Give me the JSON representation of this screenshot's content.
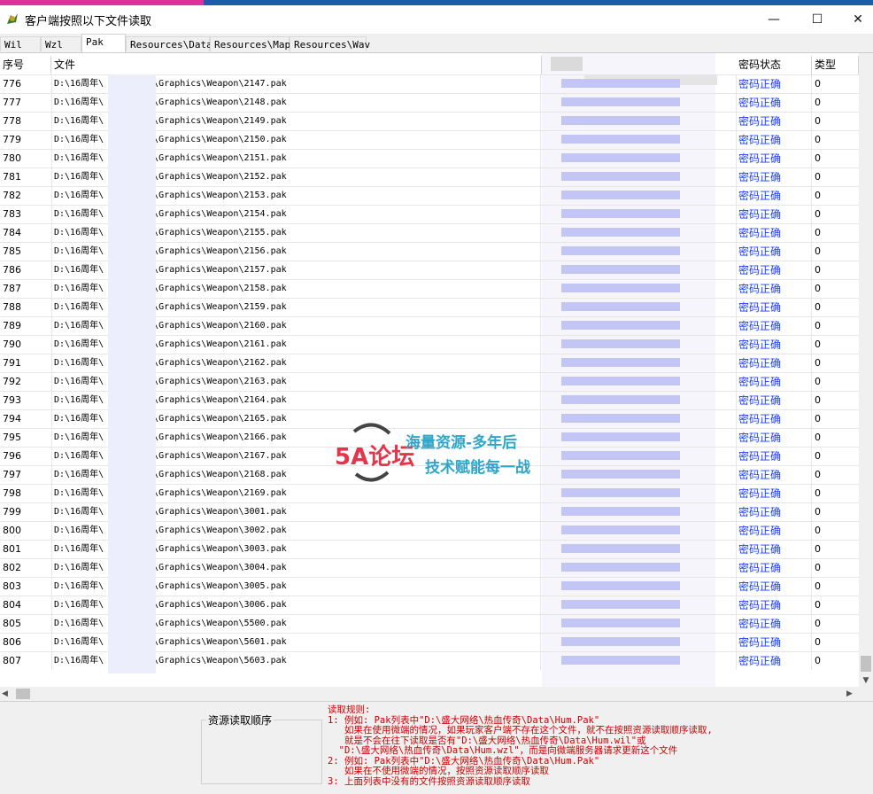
{
  "window": {
    "title": "客户端按照以下文件读取",
    "controls": {
      "minimize": "—",
      "maximize": "☐",
      "close": "✕"
    }
  },
  "tabs": [
    "Wil",
    "Wzl",
    "Pak",
    "Resources\\Data",
    "Resources\\Map",
    "Resources\\Wav"
  ],
  "active_tab": "Pak",
  "table": {
    "columns": [
      "序号",
      "文件",
      "密码状态",
      "类型"
    ],
    "rows": [
      {
        "idx": "776",
        "file": "D:\\16周年\\",
        "path": "\\Graphics\\Weapon\\2147.pak",
        "pwd": "密码正确",
        "type": "0"
      },
      {
        "idx": "777",
        "file": "D:\\16周年\\",
        "path": "\\Graphics\\Weapon\\2148.pak",
        "pwd": "密码正确",
        "type": "0"
      },
      {
        "idx": "778",
        "file": "D:\\16周年\\",
        "path": "\\Graphics\\Weapon\\2149.pak",
        "pwd": "密码正确",
        "type": "0"
      },
      {
        "idx": "779",
        "file": "D:\\16周年\\",
        "path": "\\Graphics\\Weapon\\2150.pak",
        "pwd": "密码正确",
        "type": "0"
      },
      {
        "idx": "780",
        "file": "D:\\16周年\\",
        "path": "\\Graphics\\Weapon\\2151.pak",
        "pwd": "密码正确",
        "type": "0"
      },
      {
        "idx": "781",
        "file": "D:\\16周年\\",
        "path": "\\Graphics\\Weapon\\2152.pak",
        "pwd": "密码正确",
        "type": "0"
      },
      {
        "idx": "782",
        "file": "D:\\16周年\\",
        "path": "\\Graphics\\Weapon\\2153.pak",
        "pwd": "密码正确",
        "type": "0"
      },
      {
        "idx": "783",
        "file": "D:\\16周年\\",
        "path": "\\Graphics\\Weapon\\2154.pak",
        "pwd": "密码正确",
        "type": "0"
      },
      {
        "idx": "784",
        "file": "D:\\16周年\\",
        "path": "\\Graphics\\Weapon\\2155.pak",
        "pwd": "密码正确",
        "type": "0"
      },
      {
        "idx": "785",
        "file": "D:\\16周年\\",
        "path": "\\Graphics\\Weapon\\2156.pak",
        "pwd": "密码正确",
        "type": "0"
      },
      {
        "idx": "786",
        "file": "D:\\16周年\\",
        "path": "\\Graphics\\Weapon\\2157.pak",
        "pwd": "密码正确",
        "type": "0"
      },
      {
        "idx": "787",
        "file": "D:\\16周年\\",
        "path": "\\Graphics\\Weapon\\2158.pak",
        "pwd": "密码正确",
        "type": "0"
      },
      {
        "idx": "788",
        "file": "D:\\16周年\\",
        "path": "\\Graphics\\Weapon\\2159.pak",
        "pwd": "密码正确",
        "type": "0"
      },
      {
        "idx": "789",
        "file": "D:\\16周年\\",
        "path": "\\Graphics\\Weapon\\2160.pak",
        "pwd": "密码正确",
        "type": "0"
      },
      {
        "idx": "790",
        "file": "D:\\16周年\\",
        "path": "\\Graphics\\Weapon\\2161.pak",
        "pwd": "密码正确",
        "type": "0"
      },
      {
        "idx": "791",
        "file": "D:\\16周年\\",
        "path": "\\Graphics\\Weapon\\2162.pak",
        "pwd": "密码正确",
        "type": "0"
      },
      {
        "idx": "792",
        "file": "D:\\16周年\\",
        "path": "\\Graphics\\Weapon\\2163.pak",
        "pwd": "密码正确",
        "type": "0"
      },
      {
        "idx": "793",
        "file": "D:\\16周年\\",
        "path": "\\Graphics\\Weapon\\2164.pak",
        "pwd": "密码正确",
        "type": "0"
      },
      {
        "idx": "794",
        "file": "D:\\16周年\\",
        "path": "\\Graphics\\Weapon\\2165.pak",
        "pwd": "密码正确",
        "type": "0"
      },
      {
        "idx": "795",
        "file": "D:\\16周年\\",
        "path": "\\Graphics\\Weapon\\2166.pak",
        "pwd": "密码正确",
        "type": "0"
      },
      {
        "idx": "796",
        "file": "D:\\16周年\\",
        "path": "\\Graphics\\Weapon\\2167.pak",
        "pwd": "密码正确",
        "type": "0"
      },
      {
        "idx": "797",
        "file": "D:\\16周年\\",
        "path": "\\Graphics\\Weapon\\2168.pak",
        "pwd": "密码正确",
        "type": "0"
      },
      {
        "idx": "798",
        "file": "D:\\16周年\\",
        "path": "\\Graphics\\Weapon\\2169.pak",
        "pwd": "密码正确",
        "type": "0"
      },
      {
        "idx": "799",
        "file": "D:\\16周年\\",
        "path": "\\Graphics\\Weapon\\3001.pak",
        "pwd": "密码正确",
        "type": "0"
      },
      {
        "idx": "800",
        "file": "D:\\16周年\\",
        "path": "\\Graphics\\Weapon\\3002.pak",
        "pwd": "密码正确",
        "type": "0"
      },
      {
        "idx": "801",
        "file": "D:\\16周年\\",
        "path": "\\Graphics\\Weapon\\3003.pak",
        "pwd": "密码正确",
        "type": "0"
      },
      {
        "idx": "802",
        "file": "D:\\16周年\\",
        "path": "\\Graphics\\Weapon\\3004.pak",
        "pwd": "密码正确",
        "type": "0"
      },
      {
        "idx": "803",
        "file": "D:\\16周年\\",
        "path": "\\Graphics\\Weapon\\3005.pak",
        "pwd": "密码正确",
        "type": "0"
      },
      {
        "idx": "804",
        "file": "D:\\16周年\\",
        "path": "\\Graphics\\Weapon\\3006.pak",
        "pwd": "密码正确",
        "type": "0"
      },
      {
        "idx": "805",
        "file": "D:\\16周年\\",
        "path": "\\Graphics\\Weapon\\5500.pak",
        "pwd": "密码正确",
        "type": "0"
      },
      {
        "idx": "806",
        "file": "D:\\16周年\\",
        "path": "\\Graphics\\Weapon\\5601.pak",
        "pwd": "密码正确",
        "type": "0"
      },
      {
        "idx": "807",
        "file": "D:\\16周年\\",
        "path": "\\Graphics\\Weapon\\5603.pak",
        "pwd": "密码正确",
        "type": "0"
      }
    ]
  },
  "watermark": {
    "logo": "5A论坛",
    "line1": "海量资源-多年后",
    "line2": "技术赋能每一战"
  },
  "bottom": {
    "group_title": "资源读取顺序",
    "rules": [
      "读取规则:",
      "1: 例如: Pak列表中\"D:\\盛大网络\\热血传奇\\Data\\Hum.Pak\"",
      "   如果在使用微端的情况，如果玩家客户端不存在这个文件，就不在按照资源读取顺序读取,",
      "   就是不会在往下读取是否有\"D:\\盛大网络\\热血传奇\\Data\\Hum.wil\"或",
      "  \"D:\\盛大网络\\热血传奇\\Data\\Hum.wzl\"，而是向微端服务器请求更新这个文件",
      "2: 例如: Pak列表中\"D:\\盛大网络\\热血传奇\\Data\\Hum.Pak\"",
      "   如果在不使用微端的情况，按照资源读取顺序读取",
      "3: 上面列表中没有的文件按照资源读取顺序读取"
    ]
  },
  "colors": {
    "password_ok": "#1a3dff",
    "rules_text": "#cc0000",
    "titlebar_accent": "#1e5ba8"
  }
}
